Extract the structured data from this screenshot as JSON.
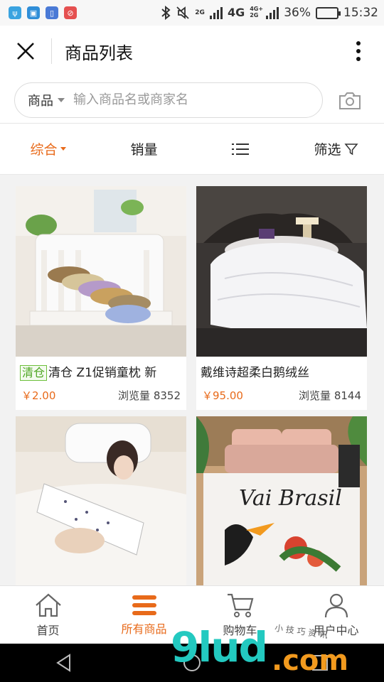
{
  "status_bar": {
    "network_left": "2G",
    "network_main": "4G",
    "network_sub": "4G+ 2G",
    "battery_percent": "36%",
    "time": "15:32",
    "battery_level": 0.36
  },
  "header": {
    "title": "商品列表",
    "close_icon": "close-icon",
    "more_icon": "more-vertical-icon"
  },
  "search": {
    "scope_label": "商品",
    "placeholder": "输入商品名或商家名",
    "camera_icon": "camera-icon"
  },
  "sort_bar": {
    "tabs": [
      {
        "label": "综合",
        "active": true
      },
      {
        "label": "销量",
        "active": false
      },
      {
        "label": "",
        "icon": "list-view-icon"
      },
      {
        "label": "筛选",
        "icon": "filter-icon"
      }
    ],
    "accent_color": "#e86a1a"
  },
  "products": [
    {
      "tag": "清仓",
      "name": "清仓 Z1促销童枕 新",
      "price": "￥2.00",
      "views": "浏览量 8352"
    },
    {
      "tag": "",
      "name": "戴维诗超柔白鹅绒丝",
      "price": "￥95.00",
      "views": "浏览量 8144"
    },
    {
      "tag": "",
      "name": "",
      "price": "",
      "views": ""
    },
    {
      "tag": "",
      "name": "",
      "price": "",
      "views": ""
    }
  ],
  "product_images": {
    "p4_print_text": "Vai Brasil"
  },
  "tab_bar": {
    "tabs": [
      {
        "label": "首页",
        "icon": "home-icon"
      },
      {
        "label": "所有商品",
        "icon": "menu-icon",
        "active": true
      },
      {
        "label": "购物车",
        "icon": "cart-icon"
      },
      {
        "label": "用户中心",
        "icon": "user-icon"
      }
    ]
  },
  "watermark": {
    "brand": "9lud",
    "suffix": ".com",
    "small_text": "小 技 巧 资 讯"
  }
}
